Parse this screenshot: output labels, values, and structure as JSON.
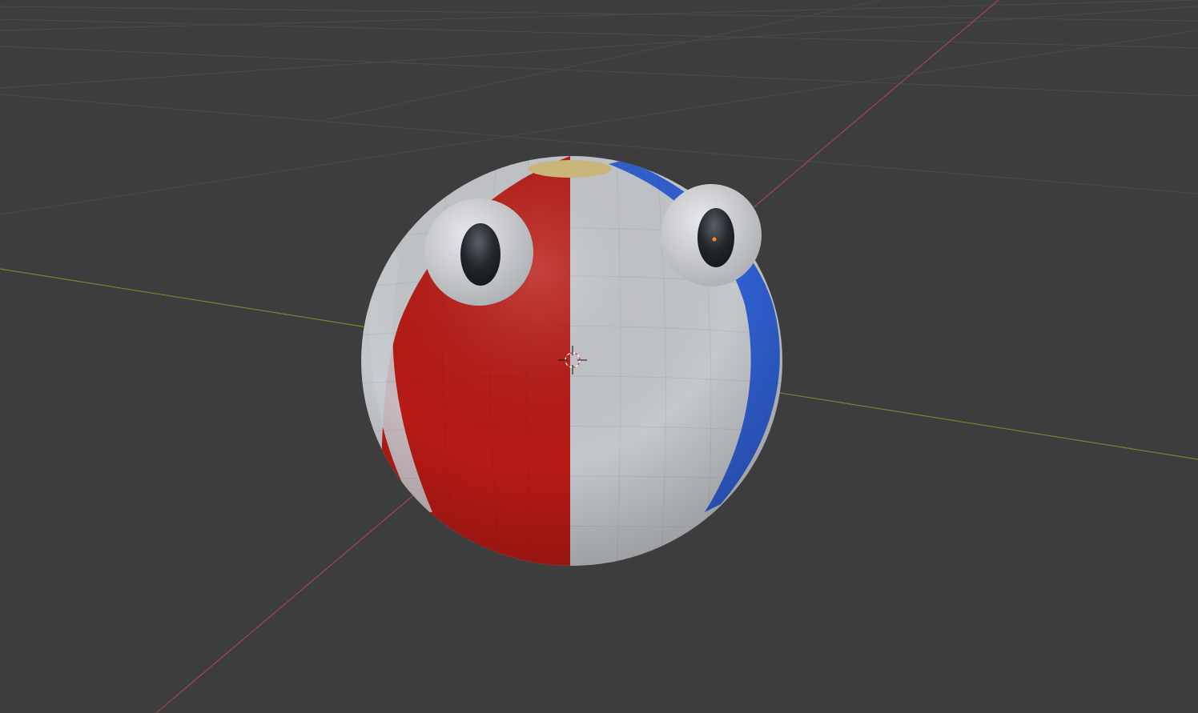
{
  "viewport": {
    "background_color": "#3d3d3d",
    "grid_line_color": "#4a4a4a",
    "x_axis_color": "#9c4a4f",
    "y_axis_color": "#6e8b2e"
  },
  "scene_object": {
    "name": "beach-ball-character",
    "stripe_colors": {
      "red": "#b81a14",
      "white": "#c4c7cb",
      "blue": "#2f5fd0",
      "cap": "#c9b57a"
    },
    "eyes": {
      "sclera_color": "#cfd1d4",
      "pupil_color": "#1c1f24"
    }
  },
  "cursor": {
    "icon": "3d-cursor-icon"
  },
  "origin_marker": {
    "icon": "object-origin-icon",
    "color": "#ff8a1a"
  }
}
